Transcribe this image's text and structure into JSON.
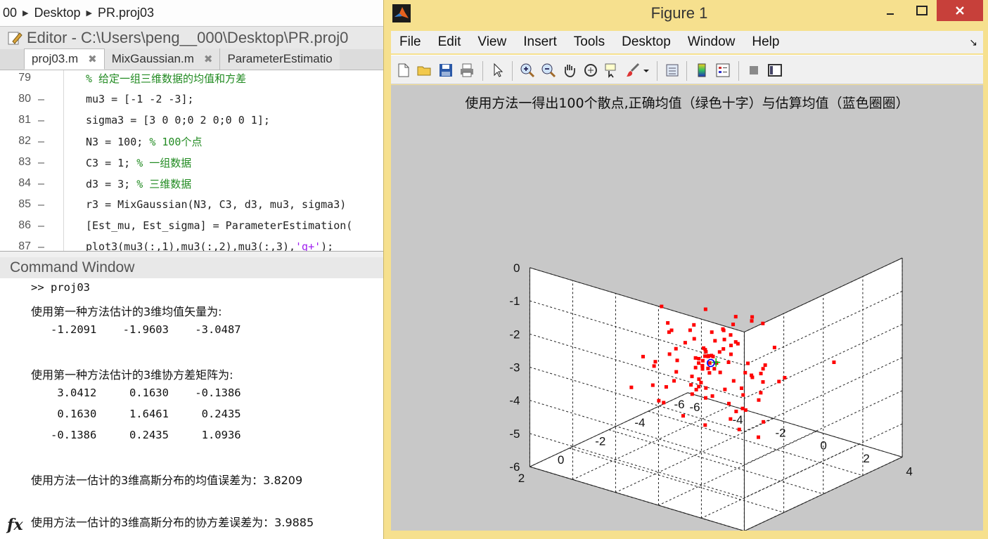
{
  "matlab": {
    "breadcrumb": [
      "00",
      "Desktop",
      "PR.proj03"
    ],
    "editor_title": "Editor - C:\\Users\\peng__000\\Desktop\\PR.proj0",
    "tabs": [
      {
        "label": "proj03.m",
        "close": "✖"
      },
      {
        "label": "MixGaussian.m",
        "close": "✖"
      },
      {
        "label": "ParameterEstimatio",
        "close": ""
      }
    ],
    "code": [
      {
        "ln": "79",
        "dash": "",
        "parts": [
          {
            "t": "% 给定一组三维数据的均值和方差",
            "c": "cmt"
          }
        ]
      },
      {
        "ln": "80",
        "dash": "–",
        "parts": [
          {
            "t": "mu3 = [-1 -2 -3];",
            "c": ""
          }
        ]
      },
      {
        "ln": "81",
        "dash": "–",
        "parts": [
          {
            "t": "sigma3 = [3 0 0;0 2 0;0 0 1];",
            "c": ""
          }
        ]
      },
      {
        "ln": "82",
        "dash": "–",
        "parts": [
          {
            "t": "N3 = 100; ",
            "c": ""
          },
          {
            "t": "% 100个点",
            "c": "cmt"
          }
        ]
      },
      {
        "ln": "83",
        "dash": "–",
        "parts": [
          {
            "t": "C3 = 1;   ",
            "c": ""
          },
          {
            "t": "% 一组数据",
            "c": "cmt"
          }
        ]
      },
      {
        "ln": "84",
        "dash": "–",
        "parts": [
          {
            "t": "d3 = 3;   ",
            "c": ""
          },
          {
            "t": "% 三维数据",
            "c": "cmt"
          }
        ]
      },
      {
        "ln": "85",
        "dash": "–",
        "parts": [
          {
            "t": "r3 = MixGaussian(N3, C3, d3, mu3, sigma3)",
            "c": ""
          }
        ]
      },
      {
        "ln": "86",
        "dash": "–",
        "parts": [
          {
            "t": "[Est_mu, Est_sigma] = ParameterEstimation(",
            "c": ""
          }
        ]
      },
      {
        "ln": "87",
        "dash": "–",
        "parts": [
          {
            "t": "plot3(mu3(:,1),mu3(:,2),mu3(:,3),",
            "c": ""
          },
          {
            "t": "'g+'",
            "c": "str"
          },
          {
            "t": ");",
            "c": ""
          }
        ]
      }
    ],
    "command_window_title": "Command Window",
    "command_lines": [
      {
        "t": ">> proj03",
        "cn": false
      },
      {
        "t": "使用第一种方法估计的3维均值矢量为:",
        "cn": true
      },
      {
        "t": "   -1.2091    -1.9603    -3.0487",
        "cn": false
      },
      {
        "t": "",
        "cn": false
      },
      {
        "t": "使用第一种方法估计的3维协方差矩阵为:",
        "cn": true
      },
      {
        "t": "    3.0412     0.1630    -0.1386",
        "cn": false
      },
      {
        "t": "    0.1630     1.6461     0.2435",
        "cn": false
      },
      {
        "t": "   -0.1386     0.2435     1.0936",
        "cn": false
      },
      {
        "t": "",
        "cn": false
      },
      {
        "t": "使用方法一估计的3维高斯分布的均值误差为：3.8209",
        "cn": true
      },
      {
        "t": "",
        "cn": false
      },
      {
        "t": "使用方法一估计的3维高斯分布的协方差误差为：3.9885",
        "cn": true
      }
    ],
    "fx_label": "fx"
  },
  "figure": {
    "window_title": "Figure 1",
    "menu": [
      "File",
      "Edit",
      "View",
      "Insert",
      "Tools",
      "Desktop",
      "Window",
      "Help"
    ],
    "toolbar_icons": [
      "new-file-icon",
      "open-folder-icon",
      "save-icon",
      "print-icon",
      "pointer-icon",
      "zoom-in-icon",
      "zoom-out-icon",
      "pan-icon",
      "rotate-3d-icon",
      "data-cursor-icon",
      "brush-icon",
      "link-plot-icon",
      "colorbar-icon",
      "legend-icon",
      "hide-plot-tools-icon",
      "show-plot-tools-icon"
    ]
  },
  "chart_data": {
    "type": "scatter",
    "title": "使用方法一得出100个散点,正确均值（绿色十字）与估算均值（蓝色圈圈）",
    "xlim": [
      -6,
      4
    ],
    "ylim": [
      -6,
      2
    ],
    "zlim": [
      -6,
      0
    ],
    "xticks": [
      "-6",
      "-4",
      "-2",
      "0",
      "2",
      "4"
    ],
    "yticks": [
      "-6",
      "-4",
      "-2",
      "0",
      "2"
    ],
    "zticks": [
      "0",
      "-1",
      "-2",
      "-3",
      "-4",
      "-5",
      "-6"
    ],
    "grid": true,
    "point_color": "#ff0000",
    "true_mean_color": "#00c000",
    "est_mean_color": "#0000ff",
    "true_mean": [
      -1,
      -2,
      -3
    ],
    "estimated_mean": [
      -1.2091,
      -1.9603,
      -3.0487
    ],
    "points": [
      [
        -1.36,
        -1.86,
        -1.43
      ],
      [
        0.47,
        -1.4,
        -1.17
      ],
      [
        -2.13,
        1.06,
        -3.12
      ],
      [
        -1.03,
        1.17,
        -2.81
      ],
      [
        0.4,
        -1.85,
        -3.67
      ],
      [
        -3.97,
        -3.1,
        -4.44
      ],
      [
        -2.03,
        -0.22,
        -3.86
      ],
      [
        -2.04,
        -1.91,
        -3.6
      ],
      [
        -2.84,
        -0.86,
        -3.15
      ],
      [
        -1.05,
        -1.72,
        -3.25
      ],
      [
        -0.98,
        -4.25,
        -3.96
      ],
      [
        -1.91,
        -2.12,
        -3.1
      ],
      [
        1.33,
        -2.43,
        -2.22
      ],
      [
        0.44,
        -1.78,
        -4.05
      ],
      [
        -1.14,
        -1.83,
        -3.0
      ],
      [
        -0.61,
        -2.21,
        -2.98
      ],
      [
        -1.33,
        -1.81,
        -2.63
      ],
      [
        2.85,
        -3.79,
        -2.75
      ],
      [
        -1.94,
        -0.99,
        -2.49
      ],
      [
        -3.83,
        -2.0,
        -3.53
      ],
      [
        -1.53,
        -3.33,
        -3.23
      ],
      [
        2.19,
        -0.68,
        -4.27
      ],
      [
        -0.2,
        -3.62,
        -3.38
      ],
      [
        1.43,
        -0.86,
        -3.65
      ],
      [
        -2.2,
        -0.65,
        -4.07
      ],
      [
        -0.64,
        -2.03,
        -2.25
      ],
      [
        -2.32,
        -1.42,
        -3.38
      ],
      [
        -0.74,
        -3.33,
        -3.35
      ],
      [
        0.48,
        -2.2,
        -1.52
      ],
      [
        -0.77,
        -0.48,
        -3.21
      ],
      [
        -1.84,
        -1.91,
        -3.96
      ],
      [
        -0.74,
        -2.09,
        -2.57
      ],
      [
        -0.16,
        -1.98,
        -3.39
      ],
      [
        -2.2,
        -3.69,
        -2.74
      ],
      [
        -2.42,
        -2.23,
        -2.37
      ],
      [
        -2.35,
        -2.43,
        -3.54
      ],
      [
        -0.06,
        -3.36,
        -3.39
      ],
      [
        -0.03,
        -1.68,
        -4.43
      ],
      [
        0.43,
        -2.24,
        -3.18
      ],
      [
        -2.92,
        -0.39,
        -2.75
      ],
      [
        -1.07,
        -1.55,
        -3.96
      ],
      [
        -1.24,
        -3.0,
        -2.5
      ],
      [
        -1.33,
        -2.38,
        -3.19
      ],
      [
        0.68,
        0.01,
        -3.13
      ],
      [
        -0.36,
        0.36,
        -3.83
      ],
      [
        -1.61,
        -0.14,
        -3.34
      ],
      [
        2.5,
        -0.36,
        -3.0
      ],
      [
        -2.6,
        -0.98,
        -1.34
      ],
      [
        -0.57,
        -3.91,
        -4.04
      ],
      [
        -1.79,
        -1.82,
        -2.97
      ],
      [
        -0.33,
        -2.75,
        -3.39
      ],
      [
        -4.06,
        -2.88,
        -2.65
      ],
      [
        -0.97,
        -1.1,
        -3.25
      ],
      [
        -4.25,
        -3.15,
        -3.04
      ],
      [
        -0.1,
        -4.21,
        -4.02
      ],
      [
        -3.11,
        -2.73,
        -3.02
      ],
      [
        0.5,
        -2.21,
        -3.22
      ],
      [
        -1.48,
        -3.28,
        -2.94
      ],
      [
        0.15,
        -1.2,
        -3.37
      ],
      [
        -1.59,
        -2.08,
        -2.95
      ],
      [
        -0.91,
        -1.85,
        -2.29
      ],
      [
        -1.63,
        -3.55,
        -2.41
      ],
      [
        -1.74,
        -3.8,
        -3.03
      ],
      [
        -1.3,
        -1.93,
        -2.86
      ],
      [
        -2.16,
        -2.59,
        -3.34
      ],
      [
        0.84,
        -1.02,
        -3.85
      ],
      [
        -2.68,
        -1.47,
        -2.93
      ],
      [
        -0.77,
        -2.4,
        -4.31
      ],
      [
        -2.62,
        -3.13,
        -3.2
      ],
      [
        -1.84,
        -3.26,
        -2.51
      ],
      [
        -0.32,
        -0.71,
        -4.4
      ],
      [
        0.03,
        -2.71,
        -1.63
      ],
      [
        -0.36,
        -3.57,
        -4.23
      ],
      [
        -0.96,
        -1.55,
        -3.05
      ],
      [
        -3.29,
        -2.52,
        -3.53
      ],
      [
        -1.58,
        -2.84,
        -3.65
      ],
      [
        -3.34,
        -3.42,
        -2.72
      ],
      [
        -0.96,
        -1.57,
        -2.68
      ],
      [
        0.53,
        -1.63,
        -3.38
      ],
      [
        -1.29,
        -1.62,
        -3.05
      ],
      [
        -1.1,
        -0.9,
        -3.67
      ],
      [
        -1.59,
        -1.88,
        -3.69
      ],
      [
        -4.15,
        -3.17,
        -2.97
      ],
      [
        -1.29,
        -1.44,
        -3.63
      ],
      [
        2.57,
        -0.52,
        -3.69
      ],
      [
        -1.14,
        -2.0,
        -2.85
      ],
      [
        -2.45,
        -3.36,
        -2.75
      ],
      [
        -0.82,
        -1.57,
        -2.64
      ],
      [
        -1.06,
        -1.55,
        -3.66
      ],
      [
        1.28,
        -3.0,
        -3.3
      ],
      [
        0.45,
        -1.6,
        -4.63
      ],
      [
        -0.52,
        -3.85,
        -2.25
      ],
      [
        -1.56,
        -1.92,
        -3.2
      ],
      [
        -0.1,
        -2.13,
        -2.3
      ],
      [
        -2.31,
        -2.91,
        -3.19
      ],
      [
        -1.57,
        -1.74,
        -3.06
      ],
      [
        -2.13,
        -3.14,
        -3.73
      ],
      [
        -1.65,
        -2.02,
        -3.33
      ],
      [
        -1.4,
        -1.33,
        -2.18
      ],
      [
        -1.47,
        -2.69,
        -2.97
      ]
    ]
  }
}
